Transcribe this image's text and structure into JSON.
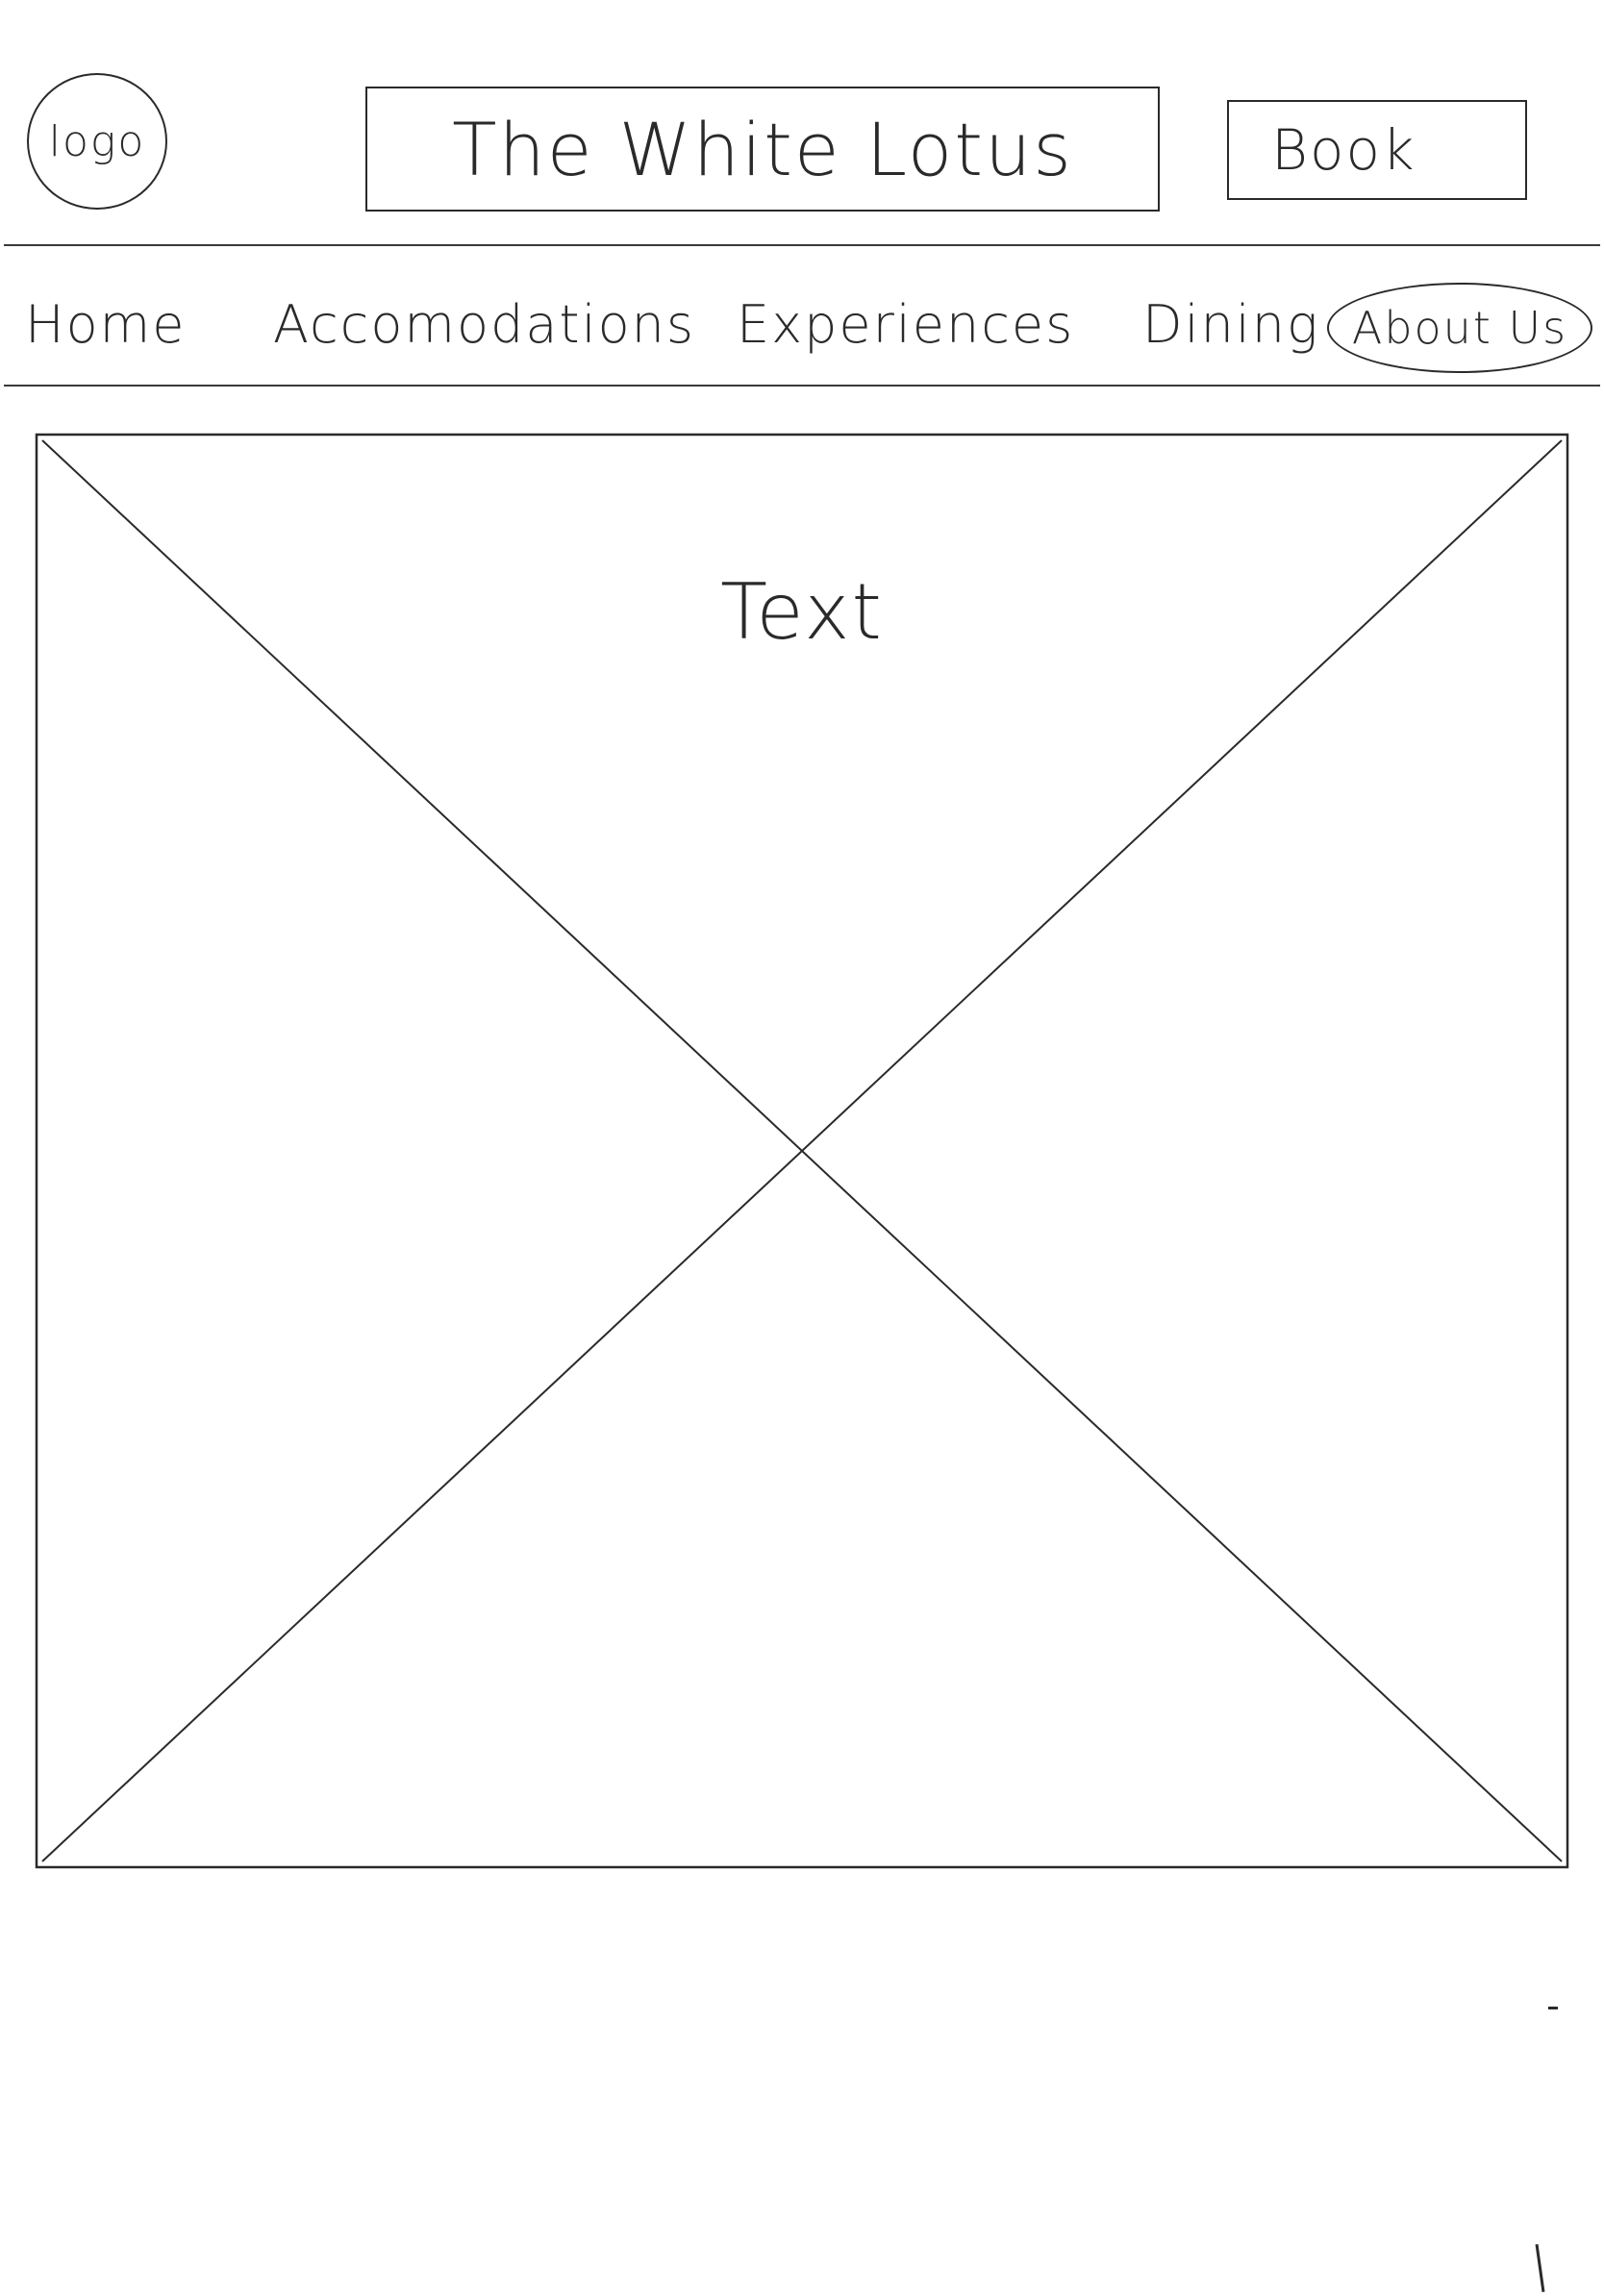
{
  "header": {
    "logo_text": "logo",
    "site_title": "The White Lotus",
    "book_label": "Book"
  },
  "nav": {
    "items": [
      {
        "label": "Home",
        "active": false
      },
      {
        "label": "Accomodations",
        "active": false
      },
      {
        "label": "Experiences",
        "active": false
      },
      {
        "label": "Dining",
        "active": false
      },
      {
        "label": "About Us",
        "active": true
      }
    ]
  },
  "hero": {
    "caption": "Text"
  },
  "colors": {
    "ink": "#2a2a2a",
    "paper": "#ffffff"
  }
}
